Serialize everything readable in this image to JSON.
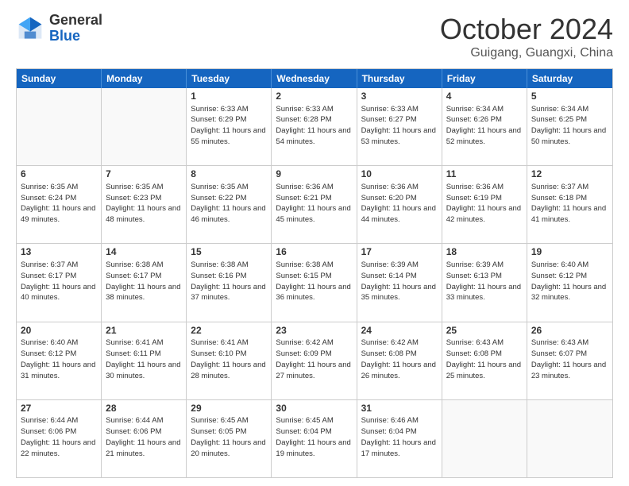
{
  "header": {
    "logo_general": "General",
    "logo_blue": "Blue",
    "title": "October 2024",
    "location": "Guigang, Guangxi, China"
  },
  "days_of_week": [
    "Sunday",
    "Monday",
    "Tuesday",
    "Wednesday",
    "Thursday",
    "Friday",
    "Saturday"
  ],
  "rows": [
    [
      {
        "day": "",
        "text": ""
      },
      {
        "day": "",
        "text": ""
      },
      {
        "day": "1",
        "text": "Sunrise: 6:33 AM\nSunset: 6:29 PM\nDaylight: 11 hours and 55 minutes."
      },
      {
        "day": "2",
        "text": "Sunrise: 6:33 AM\nSunset: 6:28 PM\nDaylight: 11 hours and 54 minutes."
      },
      {
        "day": "3",
        "text": "Sunrise: 6:33 AM\nSunset: 6:27 PM\nDaylight: 11 hours and 53 minutes."
      },
      {
        "day": "4",
        "text": "Sunrise: 6:34 AM\nSunset: 6:26 PM\nDaylight: 11 hours and 52 minutes."
      },
      {
        "day": "5",
        "text": "Sunrise: 6:34 AM\nSunset: 6:25 PM\nDaylight: 11 hours and 50 minutes."
      }
    ],
    [
      {
        "day": "6",
        "text": "Sunrise: 6:35 AM\nSunset: 6:24 PM\nDaylight: 11 hours and 49 minutes."
      },
      {
        "day": "7",
        "text": "Sunrise: 6:35 AM\nSunset: 6:23 PM\nDaylight: 11 hours and 48 minutes."
      },
      {
        "day": "8",
        "text": "Sunrise: 6:35 AM\nSunset: 6:22 PM\nDaylight: 11 hours and 46 minutes."
      },
      {
        "day": "9",
        "text": "Sunrise: 6:36 AM\nSunset: 6:21 PM\nDaylight: 11 hours and 45 minutes."
      },
      {
        "day": "10",
        "text": "Sunrise: 6:36 AM\nSunset: 6:20 PM\nDaylight: 11 hours and 44 minutes."
      },
      {
        "day": "11",
        "text": "Sunrise: 6:36 AM\nSunset: 6:19 PM\nDaylight: 11 hours and 42 minutes."
      },
      {
        "day": "12",
        "text": "Sunrise: 6:37 AM\nSunset: 6:18 PM\nDaylight: 11 hours and 41 minutes."
      }
    ],
    [
      {
        "day": "13",
        "text": "Sunrise: 6:37 AM\nSunset: 6:17 PM\nDaylight: 11 hours and 40 minutes."
      },
      {
        "day": "14",
        "text": "Sunrise: 6:38 AM\nSunset: 6:17 PM\nDaylight: 11 hours and 38 minutes."
      },
      {
        "day": "15",
        "text": "Sunrise: 6:38 AM\nSunset: 6:16 PM\nDaylight: 11 hours and 37 minutes."
      },
      {
        "day": "16",
        "text": "Sunrise: 6:38 AM\nSunset: 6:15 PM\nDaylight: 11 hours and 36 minutes."
      },
      {
        "day": "17",
        "text": "Sunrise: 6:39 AM\nSunset: 6:14 PM\nDaylight: 11 hours and 35 minutes."
      },
      {
        "day": "18",
        "text": "Sunrise: 6:39 AM\nSunset: 6:13 PM\nDaylight: 11 hours and 33 minutes."
      },
      {
        "day": "19",
        "text": "Sunrise: 6:40 AM\nSunset: 6:12 PM\nDaylight: 11 hours and 32 minutes."
      }
    ],
    [
      {
        "day": "20",
        "text": "Sunrise: 6:40 AM\nSunset: 6:12 PM\nDaylight: 11 hours and 31 minutes."
      },
      {
        "day": "21",
        "text": "Sunrise: 6:41 AM\nSunset: 6:11 PM\nDaylight: 11 hours and 30 minutes."
      },
      {
        "day": "22",
        "text": "Sunrise: 6:41 AM\nSunset: 6:10 PM\nDaylight: 11 hours and 28 minutes."
      },
      {
        "day": "23",
        "text": "Sunrise: 6:42 AM\nSunset: 6:09 PM\nDaylight: 11 hours and 27 minutes."
      },
      {
        "day": "24",
        "text": "Sunrise: 6:42 AM\nSunset: 6:08 PM\nDaylight: 11 hours and 26 minutes."
      },
      {
        "day": "25",
        "text": "Sunrise: 6:43 AM\nSunset: 6:08 PM\nDaylight: 11 hours and 25 minutes."
      },
      {
        "day": "26",
        "text": "Sunrise: 6:43 AM\nSunset: 6:07 PM\nDaylight: 11 hours and 23 minutes."
      }
    ],
    [
      {
        "day": "27",
        "text": "Sunrise: 6:44 AM\nSunset: 6:06 PM\nDaylight: 11 hours and 22 minutes."
      },
      {
        "day": "28",
        "text": "Sunrise: 6:44 AM\nSunset: 6:06 PM\nDaylight: 11 hours and 21 minutes."
      },
      {
        "day": "29",
        "text": "Sunrise: 6:45 AM\nSunset: 6:05 PM\nDaylight: 11 hours and 20 minutes."
      },
      {
        "day": "30",
        "text": "Sunrise: 6:45 AM\nSunset: 6:04 PM\nDaylight: 11 hours and 19 minutes."
      },
      {
        "day": "31",
        "text": "Sunrise: 6:46 AM\nSunset: 6:04 PM\nDaylight: 11 hours and 17 minutes."
      },
      {
        "day": "",
        "text": ""
      },
      {
        "day": "",
        "text": ""
      }
    ]
  ]
}
